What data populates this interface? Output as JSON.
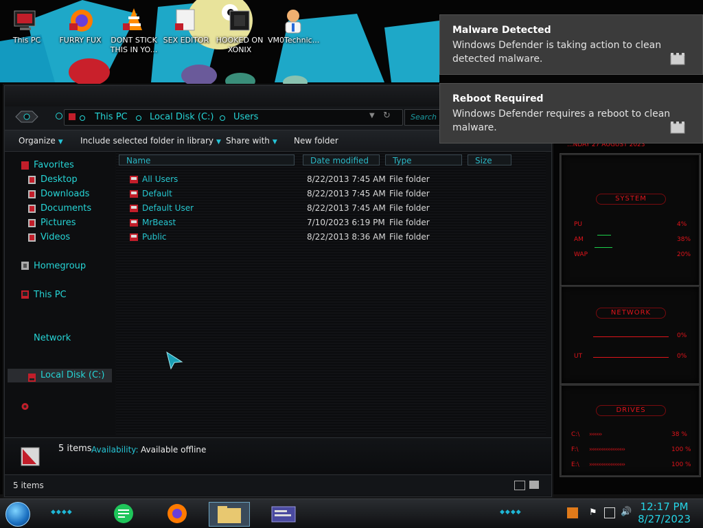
{
  "desktop": {
    "icons": [
      {
        "label": "This PC"
      },
      {
        "label": "FURRY FUX"
      },
      {
        "label": "DONT STICK THIS IN YO..."
      },
      {
        "label": "SEX EDITOR"
      },
      {
        "label": "HOOKED ON XONIX"
      },
      {
        "label": "VM0Technic..."
      }
    ]
  },
  "explorer": {
    "breadcrumb": [
      "This PC",
      "Local Disk (C:)",
      "Users"
    ],
    "search_placeholder": "Search U...",
    "toolbar": {
      "organize": "Organize",
      "include_in_library": "Include selected folder in library",
      "share_with": "Share with",
      "new_folder": "New folder"
    },
    "nav": {
      "favorites": "Favorites",
      "desktop": "Desktop",
      "downloads": "Downloads",
      "documents": "Documents",
      "pictures": "Pictures",
      "videos": "Videos",
      "homegroup": "Homegroup",
      "this_pc": "This PC",
      "local_disk": "Local Disk (C:)",
      "network": "Network"
    },
    "columns": {
      "name": "Name",
      "date_modified": "Date modified",
      "type": "Type",
      "size": "Size"
    },
    "files": [
      {
        "name": "All Users",
        "date": "8/22/2013 7:45 AM",
        "type": "File folder"
      },
      {
        "name": "Default",
        "date": "8/22/2013 7:45 AM",
        "type": "File folder"
      },
      {
        "name": "Default User",
        "date": "8/22/2013 7:45 AM",
        "type": "File folder"
      },
      {
        "name": "MrBeast",
        "date": "7/10/2023 6:19 PM",
        "type": "File folder"
      },
      {
        "name": "Public",
        "date": "8/22/2013 8:36 AM",
        "type": "File folder"
      }
    ],
    "details": {
      "count": "5 items",
      "availability_label": "Availability:",
      "availability_value": "Available offline"
    },
    "status": {
      "count": "5 items"
    }
  },
  "gadgets": {
    "header": "...NDAY 27 AUGUST 2023",
    "system": {
      "title": "SYSTEM",
      "rows": [
        {
          "label": "PU",
          "value": "4%"
        },
        {
          "label": "AM",
          "value": "38%"
        },
        {
          "label": "WAP",
          "value": "20%"
        }
      ]
    },
    "network": {
      "title": "NETWORK",
      "rows": [
        {
          "label": "",
          "value": "0%"
        },
        {
          "label": "UT",
          "value": "0%"
        }
      ]
    },
    "drives": {
      "title": "DRIVES",
      "rows": [
        {
          "label": "C:\\",
          "value": "38 %"
        },
        {
          "label": "F:\\",
          "value": "100 %"
        },
        {
          "label": "E:\\",
          "value": "100 %"
        }
      ]
    }
  },
  "taskbar": {
    "time": "12:17 PM",
    "date": "8/27/2023"
  },
  "notifications": [
    {
      "title": "Malware Detected",
      "body": "Windows Defender is taking action to clean detected malware."
    },
    {
      "title": "Reboot Required",
      "body": "Windows Defender requires a reboot to clean malware."
    }
  ],
  "colors": {
    "accent": "#26d5d6",
    "gadget_red": "#e0141b",
    "toast_bg": "#3b3b3b"
  }
}
